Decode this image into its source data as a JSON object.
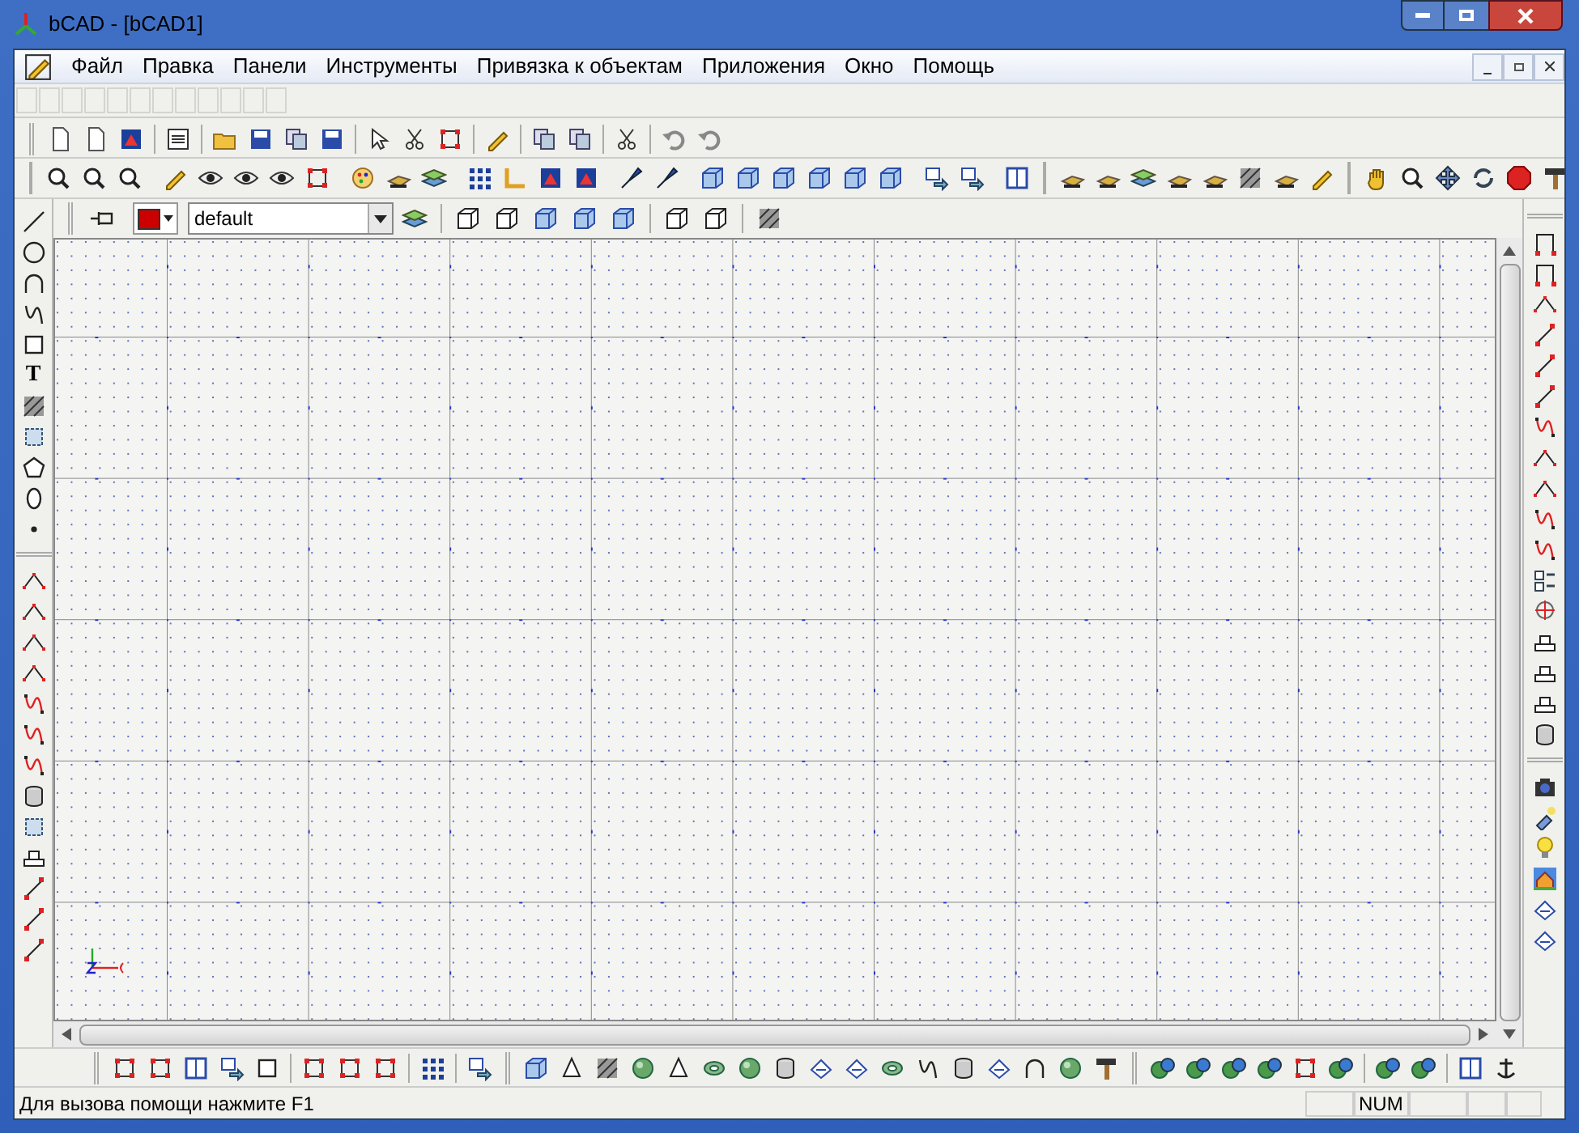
{
  "window": {
    "title": "bCAD - [bCAD1]"
  },
  "menu": [
    "Файл",
    "Правка",
    "Панели",
    "Инструменты",
    "Привязка к объектам",
    "Приложения",
    "Окно",
    "Помощь"
  ],
  "layer_bar": {
    "color": "#cc0000",
    "layer": "default"
  },
  "left_toolbar": {
    "text_tool": "T"
  },
  "status_bar": {
    "message": "Для вызова помощи нажмите F1",
    "indicator": "NUM"
  }
}
